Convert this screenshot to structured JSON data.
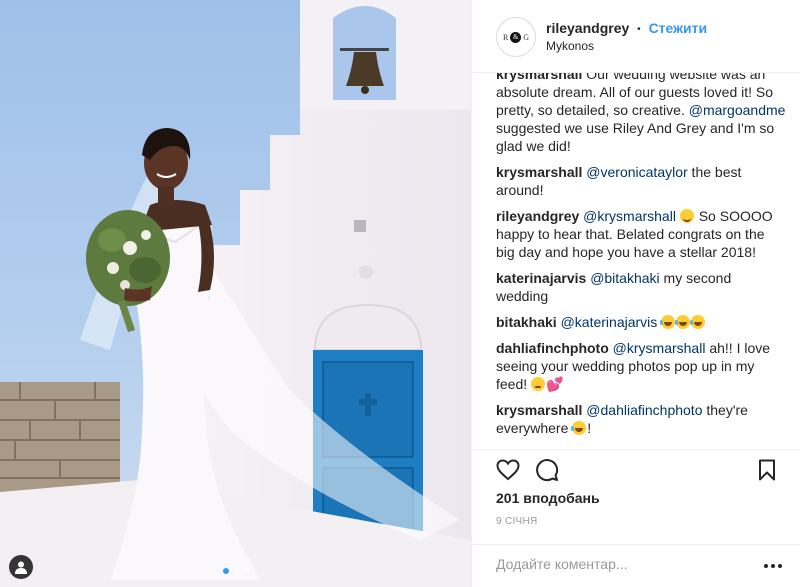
{
  "post": {
    "username": "rileyandgrey",
    "follow_label": "Стежити",
    "location": "Mykonos",
    "avatar_letters": [
      "R",
      "&",
      "G"
    ]
  },
  "photo": {
    "carousel_dots": 3,
    "active_dot": 0,
    "tag_icon": "person-tag-icon"
  },
  "comments": [
    {
      "author": "krysmarshall",
      "parts": [
        {
          "type": "text",
          "value": "Our wedding website was an absolute dream. All of our guests loved it! So pretty, so detailed, so creative. "
        },
        {
          "type": "mention",
          "value": "@margoandme"
        },
        {
          "type": "text",
          "value": " suggested we use Riley And Grey and I'm so glad we did!"
        }
      ]
    },
    {
      "author": "krysmarshall",
      "parts": [
        {
          "type": "mention",
          "value": "@veronicataylor"
        },
        {
          "type": "text",
          "value": " the best around!"
        }
      ]
    },
    {
      "author": "rileyandgrey",
      "parts": [
        {
          "type": "mention",
          "value": "@krysmarshall"
        },
        {
          "type": "text",
          "value": " "
        },
        {
          "type": "emoji",
          "value": "blush"
        },
        {
          "type": "text",
          "value": " So SOOOO happy to hear that. Belated congrats on the big day and hope you have a stellar 2018!"
        }
      ]
    },
    {
      "author": "katerinajarvis",
      "parts": [
        {
          "type": "mention",
          "value": "@bitakhaki"
        },
        {
          "type": "text",
          "value": " my second wedding"
        }
      ]
    },
    {
      "author": "bitakhaki",
      "parts": [
        {
          "type": "mention",
          "value": "@katerinajarvis"
        },
        {
          "type": "text",
          "value": " "
        },
        {
          "type": "emoji",
          "value": "laugh"
        },
        {
          "type": "emoji",
          "value": "laugh"
        },
        {
          "type": "emoji",
          "value": "laugh"
        }
      ]
    },
    {
      "author": "dahliafinchphoto",
      "parts": [
        {
          "type": "mention",
          "value": "@krysmarshall"
        },
        {
          "type": "text",
          "value": " ah!! I love seeing your wedding photos pop up in my feed! "
        },
        {
          "type": "emoji",
          "value": "worried"
        },
        {
          "type": "emoji",
          "value": "heart"
        }
      ]
    },
    {
      "author": "krysmarshall",
      "parts": [
        {
          "type": "mention",
          "value": "@dahliafinchphoto"
        },
        {
          "type": "text",
          "value": " they're everywhere "
        },
        {
          "type": "emoji",
          "value": "laugh"
        },
        {
          "type": "text",
          "value": "!"
        }
      ]
    }
  ],
  "actions": {
    "like_icon": "heart-outline-icon",
    "comment_icon": "comment-bubble-icon",
    "save_icon": "bookmark-icon",
    "likes_label": "201 вподобань",
    "date_label": "9 СІЧНЯ"
  },
  "add_comment": {
    "placeholder": "Додайте коментар...",
    "more_icon": "more-options-icon"
  },
  "colors": {
    "link_blue": "#3897f0",
    "mention_blue": "#003569",
    "door_blue": "#1e7fc4",
    "sky": "#a9c7ea"
  }
}
